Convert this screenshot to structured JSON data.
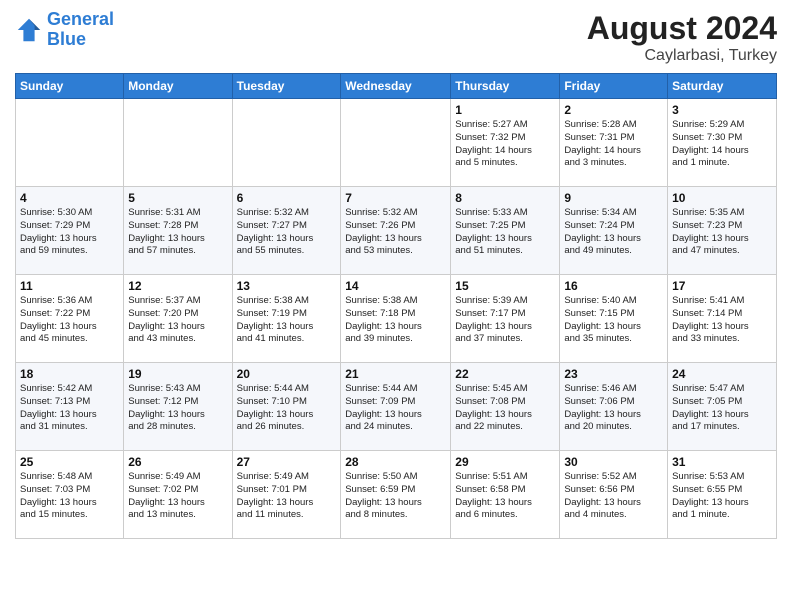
{
  "logo": {
    "line1": "General",
    "line2": "Blue"
  },
  "title": "August 2024",
  "location": "Caylarbasi, Turkey",
  "weekdays": [
    "Sunday",
    "Monday",
    "Tuesday",
    "Wednesday",
    "Thursday",
    "Friday",
    "Saturday"
  ],
  "weeks": [
    [
      {
        "day": "",
        "info": ""
      },
      {
        "day": "",
        "info": ""
      },
      {
        "day": "",
        "info": ""
      },
      {
        "day": "",
        "info": ""
      },
      {
        "day": "1",
        "info": "Sunrise: 5:27 AM\nSunset: 7:32 PM\nDaylight: 14 hours\nand 5 minutes."
      },
      {
        "day": "2",
        "info": "Sunrise: 5:28 AM\nSunset: 7:31 PM\nDaylight: 14 hours\nand 3 minutes."
      },
      {
        "day": "3",
        "info": "Sunrise: 5:29 AM\nSunset: 7:30 PM\nDaylight: 14 hours\nand 1 minute."
      }
    ],
    [
      {
        "day": "4",
        "info": "Sunrise: 5:30 AM\nSunset: 7:29 PM\nDaylight: 13 hours\nand 59 minutes."
      },
      {
        "day": "5",
        "info": "Sunrise: 5:31 AM\nSunset: 7:28 PM\nDaylight: 13 hours\nand 57 minutes."
      },
      {
        "day": "6",
        "info": "Sunrise: 5:32 AM\nSunset: 7:27 PM\nDaylight: 13 hours\nand 55 minutes."
      },
      {
        "day": "7",
        "info": "Sunrise: 5:32 AM\nSunset: 7:26 PM\nDaylight: 13 hours\nand 53 minutes."
      },
      {
        "day": "8",
        "info": "Sunrise: 5:33 AM\nSunset: 7:25 PM\nDaylight: 13 hours\nand 51 minutes."
      },
      {
        "day": "9",
        "info": "Sunrise: 5:34 AM\nSunset: 7:24 PM\nDaylight: 13 hours\nand 49 minutes."
      },
      {
        "day": "10",
        "info": "Sunrise: 5:35 AM\nSunset: 7:23 PM\nDaylight: 13 hours\nand 47 minutes."
      }
    ],
    [
      {
        "day": "11",
        "info": "Sunrise: 5:36 AM\nSunset: 7:22 PM\nDaylight: 13 hours\nand 45 minutes."
      },
      {
        "day": "12",
        "info": "Sunrise: 5:37 AM\nSunset: 7:20 PM\nDaylight: 13 hours\nand 43 minutes."
      },
      {
        "day": "13",
        "info": "Sunrise: 5:38 AM\nSunset: 7:19 PM\nDaylight: 13 hours\nand 41 minutes."
      },
      {
        "day": "14",
        "info": "Sunrise: 5:38 AM\nSunset: 7:18 PM\nDaylight: 13 hours\nand 39 minutes."
      },
      {
        "day": "15",
        "info": "Sunrise: 5:39 AM\nSunset: 7:17 PM\nDaylight: 13 hours\nand 37 minutes."
      },
      {
        "day": "16",
        "info": "Sunrise: 5:40 AM\nSunset: 7:15 PM\nDaylight: 13 hours\nand 35 minutes."
      },
      {
        "day": "17",
        "info": "Sunrise: 5:41 AM\nSunset: 7:14 PM\nDaylight: 13 hours\nand 33 minutes."
      }
    ],
    [
      {
        "day": "18",
        "info": "Sunrise: 5:42 AM\nSunset: 7:13 PM\nDaylight: 13 hours\nand 31 minutes."
      },
      {
        "day": "19",
        "info": "Sunrise: 5:43 AM\nSunset: 7:12 PM\nDaylight: 13 hours\nand 28 minutes."
      },
      {
        "day": "20",
        "info": "Sunrise: 5:44 AM\nSunset: 7:10 PM\nDaylight: 13 hours\nand 26 minutes."
      },
      {
        "day": "21",
        "info": "Sunrise: 5:44 AM\nSunset: 7:09 PM\nDaylight: 13 hours\nand 24 minutes."
      },
      {
        "day": "22",
        "info": "Sunrise: 5:45 AM\nSunset: 7:08 PM\nDaylight: 13 hours\nand 22 minutes."
      },
      {
        "day": "23",
        "info": "Sunrise: 5:46 AM\nSunset: 7:06 PM\nDaylight: 13 hours\nand 20 minutes."
      },
      {
        "day": "24",
        "info": "Sunrise: 5:47 AM\nSunset: 7:05 PM\nDaylight: 13 hours\nand 17 minutes."
      }
    ],
    [
      {
        "day": "25",
        "info": "Sunrise: 5:48 AM\nSunset: 7:03 PM\nDaylight: 13 hours\nand 15 minutes."
      },
      {
        "day": "26",
        "info": "Sunrise: 5:49 AM\nSunset: 7:02 PM\nDaylight: 13 hours\nand 13 minutes."
      },
      {
        "day": "27",
        "info": "Sunrise: 5:49 AM\nSunset: 7:01 PM\nDaylight: 13 hours\nand 11 minutes."
      },
      {
        "day": "28",
        "info": "Sunrise: 5:50 AM\nSunset: 6:59 PM\nDaylight: 13 hours\nand 8 minutes."
      },
      {
        "day": "29",
        "info": "Sunrise: 5:51 AM\nSunset: 6:58 PM\nDaylight: 13 hours\nand 6 minutes."
      },
      {
        "day": "30",
        "info": "Sunrise: 5:52 AM\nSunset: 6:56 PM\nDaylight: 13 hours\nand 4 minutes."
      },
      {
        "day": "31",
        "info": "Sunrise: 5:53 AM\nSunset: 6:55 PM\nDaylight: 13 hours\nand 1 minute."
      }
    ]
  ]
}
